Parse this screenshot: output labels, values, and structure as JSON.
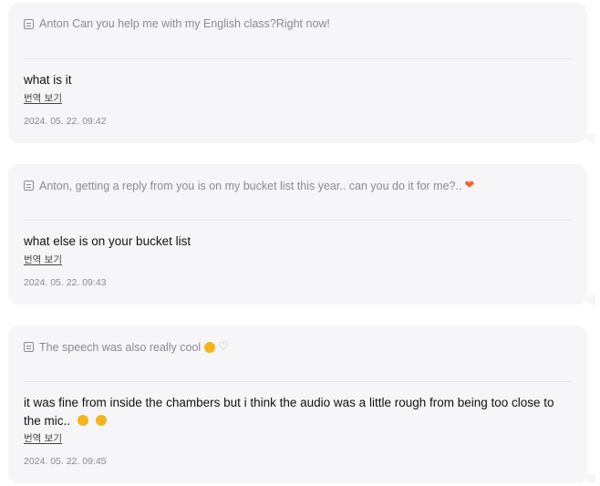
{
  "messages": [
    {
      "quote": "Anton Can you help me with my English class?Right now!",
      "quote_emojis": [],
      "faded_text": "",
      "reply": "what is it",
      "reply_emojis": [],
      "translate_label": "번역 보기",
      "timestamp": "2024. 05. 22. 09:42"
    },
    {
      "quote": "Anton, getting a reply from you is on my bucket list this year.. can you do it for me?..",
      "quote_emojis": [
        "orange-heart"
      ],
      "faded_text": "",
      "reply": "what else is on your bucket list",
      "reply_emojis": [],
      "translate_label": "번역 보기",
      "timestamp": "2024. 05. 22. 09:43"
    },
    {
      "quote": "The speech was also really cool",
      "quote_emojis": [
        "blushing-face",
        "white-heart"
      ],
      "faded_text": "",
      "reply": "it was fine from inside the chambers but i think the audio was a little rough from being too close to the mic..",
      "reply_emojis": [
        "relieved-face",
        "smiling-sweat-face"
      ],
      "translate_label": "번역 보기",
      "timestamp": "2024. 05. 22. 09:45"
    }
  ],
  "colors": {
    "card_bg": "#f6f6f8",
    "quote_text": "#8a8a92",
    "reply_text": "#111111",
    "heart": "#f0642c"
  }
}
